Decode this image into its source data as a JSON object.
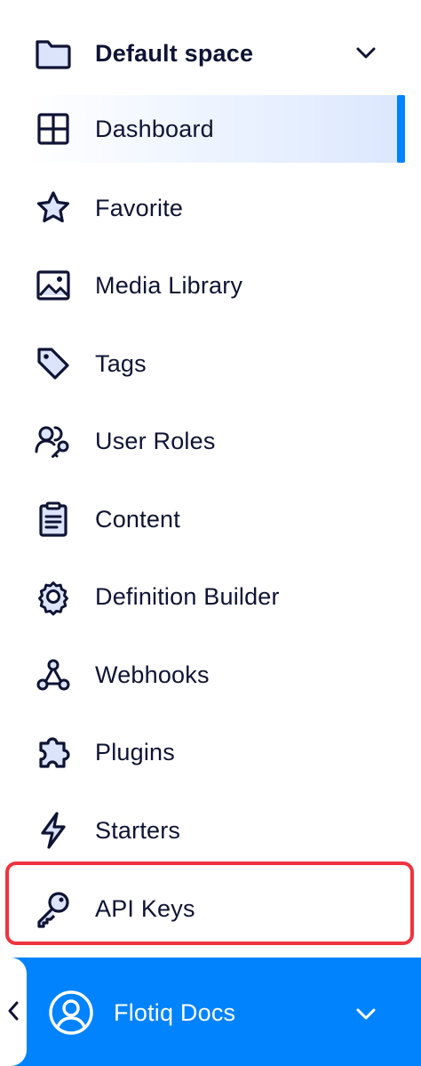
{
  "space": {
    "name": "Default space",
    "icon": "folder-icon",
    "toggle_icon": "chevron-down-icon"
  },
  "nav": {
    "items": [
      {
        "label": "Dashboard",
        "icon": "dashboard-grid-icon",
        "active": true
      },
      {
        "label": "Favorite",
        "icon": "star-icon"
      },
      {
        "label": "Media Library",
        "icon": "image-icon"
      },
      {
        "label": "Tags",
        "icon": "tag-icon"
      },
      {
        "label": "User Roles",
        "icon": "user-roles-icon"
      },
      {
        "label": "Content",
        "icon": "clipboard-icon"
      },
      {
        "label": "Definition Builder",
        "icon": "gear-icon"
      },
      {
        "label": "Webhooks",
        "icon": "webhooks-icon"
      },
      {
        "label": "Plugins",
        "icon": "puzzle-icon"
      },
      {
        "label": "Starters",
        "icon": "lightning-icon"
      },
      {
        "label": "API Keys",
        "icon": "key-icon",
        "highlighted": true
      }
    ]
  },
  "footer": {
    "user_name": "Flotiq Docs",
    "avatar_icon": "user-circle-icon",
    "collapse_icon": "chevron-left-icon",
    "menu_icon": "chevron-down-icon"
  },
  "colors": {
    "text": "#0f1334",
    "accent": "#0083fc",
    "active_bg": "#e6efff",
    "highlight": "#ef3340",
    "icon_fill": "#dbe4fb"
  }
}
